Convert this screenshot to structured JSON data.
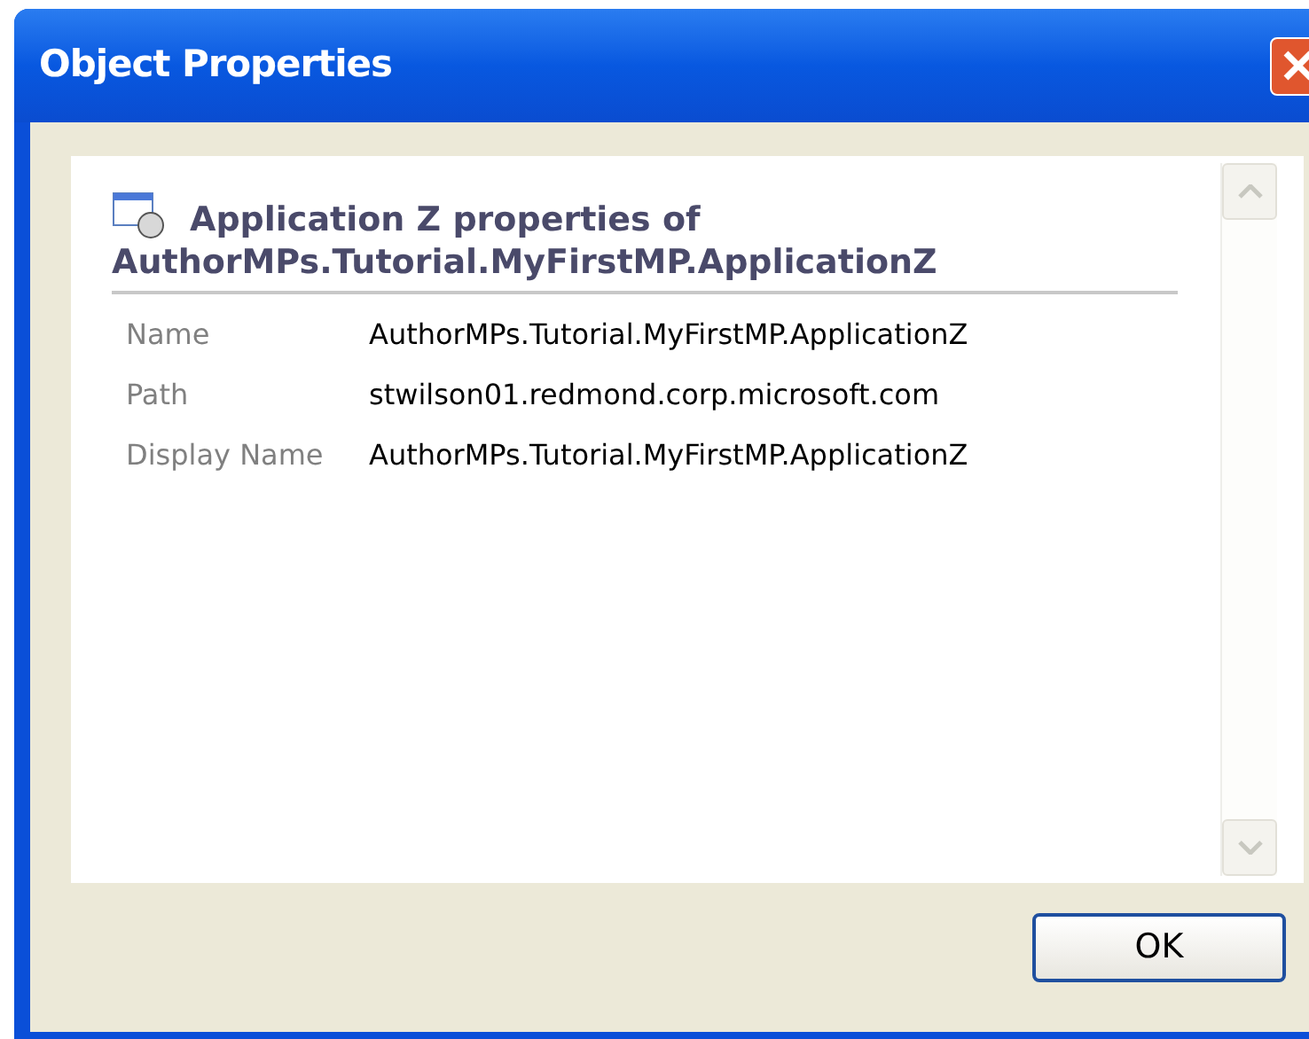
{
  "window": {
    "title": "Object Properties"
  },
  "header": {
    "line_1": "Application Z properties of",
    "line_2": "AuthorMPs.Tutorial.MyFirstMP.ApplicationZ"
  },
  "properties": [
    {
      "label": "Name",
      "value": "AuthorMPs.Tutorial.MyFirstMP.ApplicationZ"
    },
    {
      "label": "Path",
      "value": "stwilson01.redmond.corp.microsoft.com"
    },
    {
      "label": "Display Name",
      "value": "AuthorMPs.Tutorial.MyFirstMP.ApplicationZ"
    }
  ],
  "buttons": [
    "OK"
  ]
}
